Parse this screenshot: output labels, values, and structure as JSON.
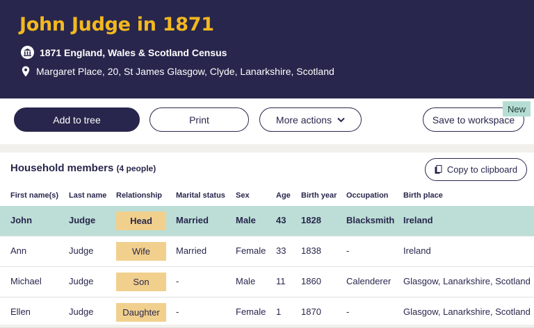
{
  "header": {
    "title": "John Judge in 1871",
    "census_label": "1871 England, Wales & Scotland Census",
    "census_icon": "census-building-icon",
    "location": "Margaret Place, 20, St James Glasgow, Clyde, Lanarkshire, Scotland",
    "location_icon": "map-pin-icon"
  },
  "toolbar": {
    "add_to_tree": "Add to tree",
    "print": "Print",
    "more_actions": "More actions",
    "save_to_workspace": "Save to workspace",
    "new_badge": "New"
  },
  "household": {
    "title": "Household members",
    "count": "(4 people)",
    "copy_button": "Copy to clipboard",
    "columns": [
      "First name(s)",
      "Last name",
      "Relationship",
      "Marital status",
      "Sex",
      "Age",
      "Birth year",
      "Occupation",
      "Birth place"
    ],
    "rows": [
      {
        "first": "John",
        "last": "Judge",
        "relationship": "Head",
        "marital": "Married",
        "sex": "Male",
        "age": "43",
        "birth_year": "1828",
        "occupation": "Blacksmith",
        "birth_place": "Ireland"
      },
      {
        "first": "Ann",
        "last": "Judge",
        "relationship": "Wife",
        "marital": "Married",
        "sex": "Female",
        "age": "33",
        "birth_year": "1838",
        "occupation": "-",
        "birth_place": "Ireland"
      },
      {
        "first": "Michael",
        "last": "Judge",
        "relationship": "Son",
        "marital": "-",
        "sex": "Male",
        "age": "11",
        "birth_year": "1860",
        "occupation": "Calenderer",
        "birth_place": "Glasgow, Lanarkshire, Scotland"
      },
      {
        "first": "Ellen",
        "last": "Judge",
        "relationship": "Daughter",
        "marital": "-",
        "sex": "Female",
        "age": "1",
        "birth_year": "1870",
        "occupation": "-",
        "birth_place": "Glasgow, Lanarkshire, Scotland"
      }
    ]
  },
  "colors": {
    "header_bg": "#28264c",
    "title": "#f2b81f",
    "highlight_row": "#bcded6",
    "relationship_tag": "#f1d08e",
    "new_badge": "#b5ddd3"
  }
}
